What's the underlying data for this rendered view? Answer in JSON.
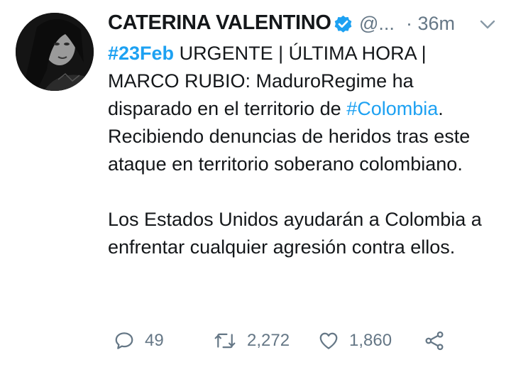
{
  "tweet": {
    "author_name": "CATERINA VALENTINO",
    "handle": "@...",
    "time": "· 36m",
    "body_hashtag_date": "#23Feb",
    "body_line1_rest": " URGENTE | ÚLTIMA HORA | MARCO RUBIO: MaduroRegime ha disparado en el territorio de ",
    "body_hashtag_country": "#Colombia",
    "body_line1_end": ". Recibiendo denuncias de heridos tras este ataque en territorio soberano colombiano.",
    "body_paragraph2": "Los Estados Unidos ayudarán a Colombia a enfrentar cualquier agresión contra ellos.",
    "reply_count": "49",
    "retweet_count": "2,272",
    "like_count": "1,860"
  },
  "icons": {
    "verified": "verified-badge-icon",
    "menu": "chevron-down-icon",
    "reply": "reply-icon",
    "retweet": "retweet-icon",
    "like": "heart-icon",
    "share": "share-icon"
  },
  "colors": {
    "text": "#14171a",
    "secondary": "#657786",
    "accent": "#1da1f2"
  }
}
